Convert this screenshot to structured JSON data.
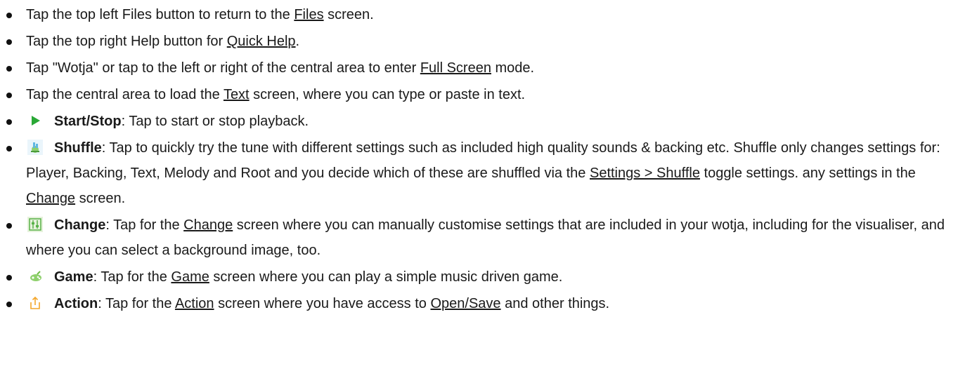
{
  "colors": {
    "play": "#2aa836",
    "shuffle": "#61b7e3",
    "change": "#58b248",
    "game": "#6fbe46",
    "action": "#f4a62a"
  },
  "items": [
    {
      "t1": "Tap the top left Files button to return to the ",
      "link1": "Files",
      "t2": " screen."
    },
    {
      "t1": "Tap the top right Help button for ",
      "link1": "Quick Help",
      "t2": "."
    },
    {
      "t1": "Tap \"Wotja\" or tap to the left or right of the central area to enter ",
      "link1": "Full Screen",
      "t2": " mode."
    },
    {
      "t1": "Tap the central area to load the ",
      "link1": "Text",
      "t2": " screen, where you can type or paste in text."
    },
    {
      "icon": "play-icon",
      "bold": "Start/Stop",
      "t1": ": Tap to start or stop playback."
    },
    {
      "icon": "shuffle-icon",
      "bold": "Shuffle",
      "t1": ": Tap to quickly try the tune with different settings such as included high quality sounds & backing etc. Shuffle only changes settings for: Player, Backing, Text, Melody and Root and you decide which of these are shuffled via the ",
      "link1": "Settings > Shuffle",
      "t2": " toggle settings. any settings in the ",
      "link2": "Change",
      "t3": " screen."
    },
    {
      "icon": "change-icon",
      "bold": "Change",
      "t1": ": Tap for the ",
      "link1": "Change",
      "t2": " screen where you can manually customise settings that are included in your wotja, including for the visualiser, and where you can select a background image, too."
    },
    {
      "icon": "game-icon",
      "bold": "Game",
      "t1": ": Tap for the ",
      "link1": "Game",
      "t2": " screen where you can play a simple music driven game."
    },
    {
      "icon": "action-icon",
      "bold": "Action",
      "t1": ": Tap for the ",
      "link1": "Action",
      "t2": " screen where you have access to ",
      "link2": "Open/Save",
      "t3": " and other things."
    }
  ]
}
